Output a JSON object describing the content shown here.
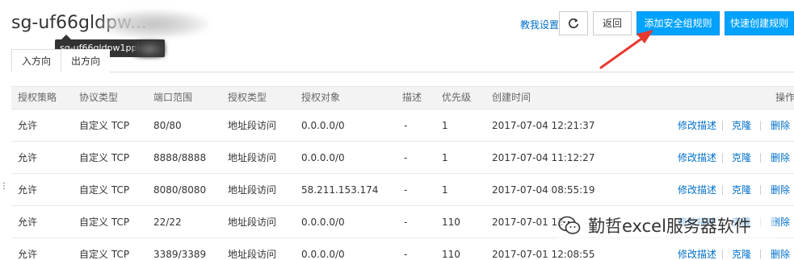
{
  "header": {
    "title": "sg-uf66gldpw...",
    "tooltip": "sg-uf66gldpw1ppi",
    "teach_link": "教我设置",
    "refresh_icon": "refresh-icon",
    "back_label": "返回",
    "add_rule_label": "添加安全组规则",
    "quick_create_label": "快速创建规则"
  },
  "tabs": [
    {
      "label": "入方向",
      "active": true
    },
    {
      "label": "出方向",
      "active": false
    }
  ],
  "table": {
    "columns": [
      "授权策略",
      "协议类型",
      "端口范围",
      "授权类型",
      "授权对象",
      "描述",
      "优先级",
      "创建时间",
      "操作"
    ],
    "rows": [
      {
        "policy": "允许",
        "protocol": "自定义 TCP",
        "port": "80/80",
        "auth_type": "地址段访问",
        "target": "0.0.0.0/0",
        "desc": "-",
        "priority": "1",
        "created": "2017-07-04 12:21:37"
      },
      {
        "policy": "允许",
        "protocol": "自定义 TCP",
        "port": "8888/8888",
        "auth_type": "地址段访问",
        "target": "0.0.0.0/0",
        "desc": "-",
        "priority": "1",
        "created": "2017-07-04 11:12:27"
      },
      {
        "policy": "允许",
        "protocol": "自定义 TCP",
        "port": "8080/8080",
        "auth_type": "地址段访问",
        "target": "58.211.153.174",
        "desc": "-",
        "priority": "1",
        "created": "2017-07-04 08:55:19"
      },
      {
        "policy": "允许",
        "protocol": "自定义 TCP",
        "port": "22/22",
        "auth_type": "地址段访问",
        "target": "0.0.0.0/0",
        "desc": "-",
        "priority": "110",
        "created": "2017-07-01 12"
      },
      {
        "policy": "允许",
        "protocol": "自定义 TCP",
        "port": "3389/3389",
        "auth_type": "地址段访问",
        "target": "0.0.0.0/0",
        "desc": "-",
        "priority": "110",
        "created": "2017-07-01 12:08:55"
      }
    ],
    "actions": {
      "edit": "修改描述",
      "clone": "克隆",
      "delete": "删除"
    }
  },
  "watermark": {
    "text": "勤哲excel服务器软件",
    "icon": "wechat-icon"
  },
  "colors": {
    "primary": "#00a2ff",
    "link": "#0070cc",
    "arrow": "#e8392e"
  }
}
